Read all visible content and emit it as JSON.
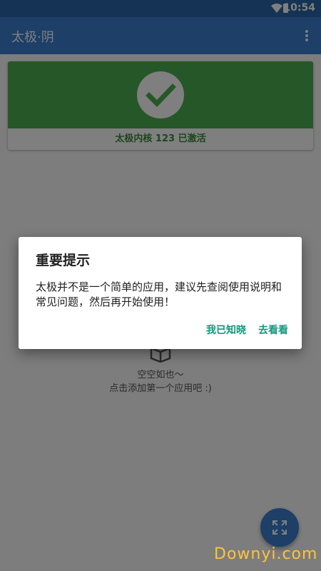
{
  "status_bar": {
    "time": "10:54"
  },
  "app_bar": {
    "title": "太极·阴",
    "menu_icon": "overflow-menu-icon"
  },
  "status_card": {
    "icon": "check-icon",
    "label": "太极内核 123 已激活",
    "accent": "#4caf50"
  },
  "empty_state": {
    "icon": "box-icon",
    "line1": "空空如也～",
    "line2": "点击添加第一个应用吧 :)"
  },
  "fab": {
    "icon": "expand-icon",
    "color": "#3a7fd0"
  },
  "dialog": {
    "title": "重要提示",
    "message": "太极并不是一个简单的应用，建议先查阅使用说明和常见问题，然后再开始使用！",
    "ok_label": "我已知晓",
    "go_label": "去看看",
    "button_color": "#13977c"
  },
  "watermark": "Downyi.com"
}
